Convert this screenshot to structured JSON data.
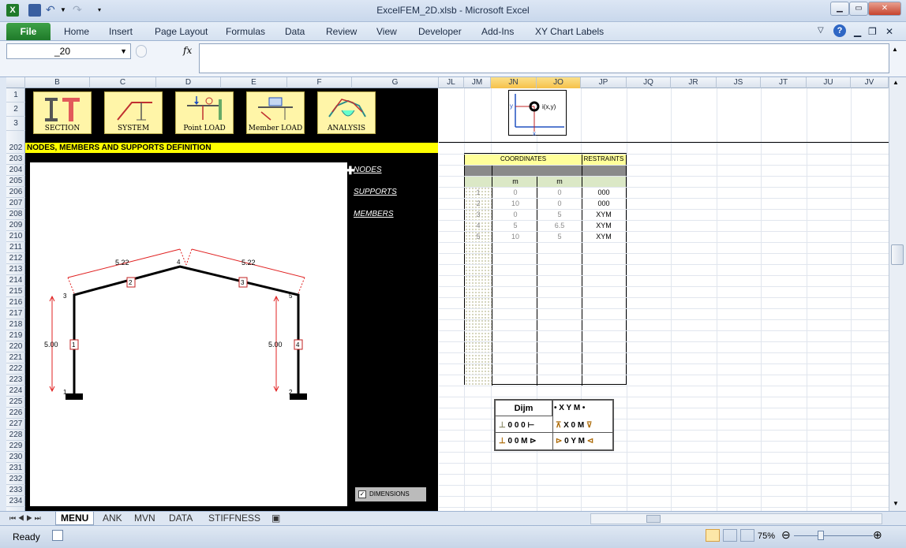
{
  "window": {
    "title": "ExcelFEM_2D.xlsb - Microsoft Excel"
  },
  "ribbon": {
    "file": "File",
    "tabs": [
      "Home",
      "Insert",
      "Page Layout",
      "Formulas",
      "Data",
      "Review",
      "View",
      "Developer",
      "Add-Ins",
      "XY Chart Labels"
    ]
  },
  "formula_bar": {
    "name_box": "_20",
    "fx": "fx",
    "formula": ""
  },
  "columns_left": [
    "B",
    "C",
    "D",
    "E",
    "F",
    "G"
  ],
  "columns_right": [
    "JL",
    "JM",
    "JN",
    "JO",
    "JP",
    "JQ",
    "JR",
    "JS",
    "JT",
    "JU",
    "JV"
  ],
  "rows_top": [
    "1",
    "2",
    "3"
  ],
  "rows_main": [
    "202",
    "203",
    "204",
    "205",
    "206",
    "207",
    "208",
    "209",
    "210",
    "211",
    "212",
    "213",
    "214",
    "215",
    "216",
    "217",
    "218",
    "219",
    "220",
    "221",
    "222",
    "223",
    "224",
    "225",
    "226",
    "227",
    "228",
    "229",
    "230",
    "231",
    "232",
    "233",
    "234"
  ],
  "menu_buttons": [
    "SECTION",
    "SYSTEM",
    "Point  LOAD",
    "Member LOAD",
    "ANALYSIS"
  ],
  "section_title": "NODES, MEMBERS AND SUPPORTS DEFINITION",
  "links": {
    "nodes": "NODES",
    "supports": "SUPPORTS",
    "members": "MEMBERS"
  },
  "dimensions_checkbox": {
    "label": "DIMENSIONS",
    "checked": true
  },
  "frame": {
    "dims": {
      "rafter_left": "5.22",
      "rafter_right": "5.22",
      "col_left": "5.00",
      "col_right": "5.00"
    },
    "node_labels": [
      "1",
      "2",
      "3",
      "4",
      "5"
    ],
    "member_labels": [
      "1",
      "2",
      "3",
      "4"
    ]
  },
  "legend_icon": {
    "label": "i(x,y)",
    "x": "x",
    "y": "y"
  },
  "table": {
    "header_coords": "COORDINATES",
    "header_restraints": "RESTRAINTS",
    "units": [
      "m",
      "m"
    ],
    "rows": [
      {
        "n": "1",
        "x": "0",
        "y": "0",
        "r": "000"
      },
      {
        "n": "2",
        "x": "10",
        "y": "0",
        "r": "000"
      },
      {
        "n": "3",
        "x": "0",
        "y": "5",
        "r": "XYM"
      },
      {
        "n": "4",
        "x": "5",
        "y": "6.5",
        "r": "XYM"
      },
      {
        "n": "5",
        "x": "10",
        "y": "5",
        "r": "XYM"
      }
    ]
  },
  "dijm_legend": {
    "title": "Dijm",
    "free": "X Y M",
    "fixed": "0 0 0",
    "xm": "X 0 M",
    "om": "0 0 M",
    "oym": "0 Y M"
  },
  "sheet_tabs": [
    "MENU",
    "ANK",
    "MVN",
    "DATA",
    "STIFFNESS"
  ],
  "status": {
    "ready": "Ready",
    "zoom": "75%"
  }
}
